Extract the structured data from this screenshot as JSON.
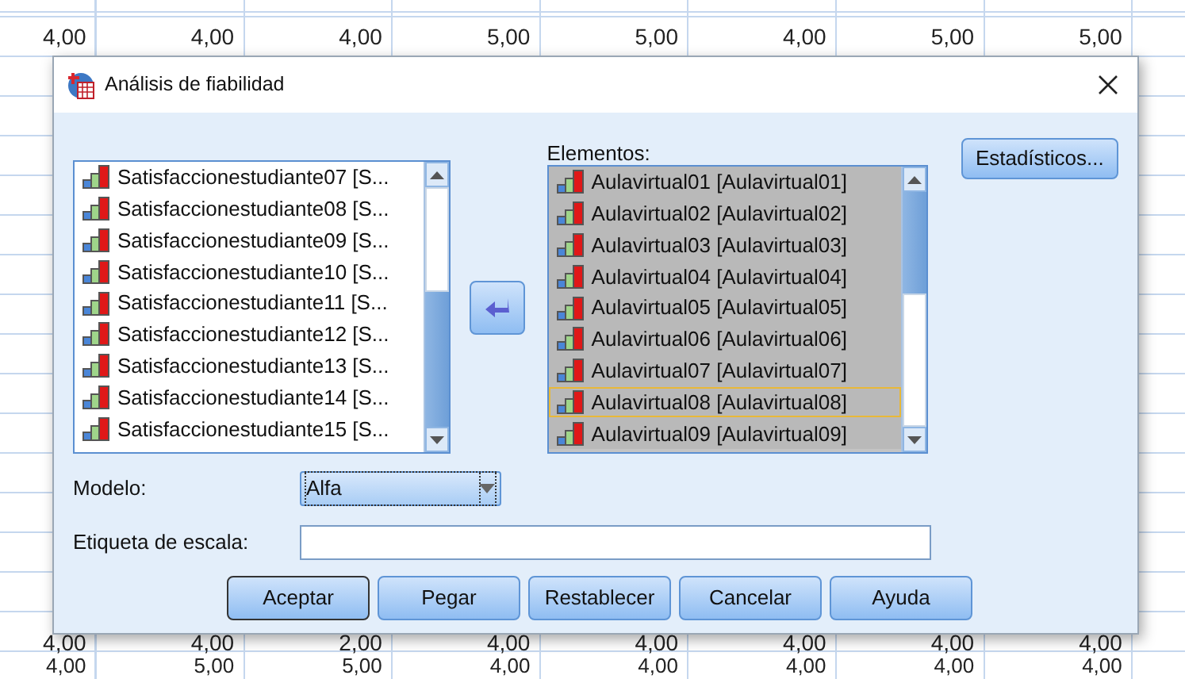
{
  "data_grid": {
    "top_rows": [
      {
        "cells": [
          "4,00",
          "4,00",
          "4,00",
          "5,00",
          "5,00",
          "4,00",
          "5,00",
          "5,00"
        ]
      }
    ],
    "bottom_rows": [
      {
        "cells": [
          "4,00",
          "4,00",
          "2,00",
          "4,00",
          "4,00",
          "4,00",
          "4,00",
          "4,00"
        ]
      },
      {
        "cells": [
          "4,00",
          "5,00",
          "5,00",
          "4,00",
          "4,00",
          "4,00",
          "4,00",
          "4,00"
        ]
      }
    ]
  },
  "dialog": {
    "title": "Análisis de fiabilidad",
    "source_list": {
      "items": [
        {
          "label": "Satisfaccionestudiante07 [S...",
          "selected": false
        },
        {
          "label": "Satisfaccionestudiante08 [S...",
          "selected": false
        },
        {
          "label": "Satisfaccionestudiante09 [S...",
          "selected": false
        },
        {
          "label": "Satisfaccionestudiante10 [S...",
          "selected": false
        },
        {
          "label": "Satisfaccionestudiante11 [S...",
          "selected": false
        },
        {
          "label": "Satisfaccionestudiante12 [S...",
          "selected": false
        },
        {
          "label": "Satisfaccionestudiante13 [S...",
          "selected": false
        },
        {
          "label": "Satisfaccionestudiante14 [S...",
          "selected": false
        },
        {
          "label": "Satisfaccionestudiante15 [S...",
          "selected": false
        }
      ]
    },
    "items_list": {
      "label": "Elementos:",
      "items": [
        {
          "label": "Aulavirtual01 [Aulavirtual01]",
          "selected": true,
          "focused": false
        },
        {
          "label": "Aulavirtual02 [Aulavirtual02]",
          "selected": true,
          "focused": false
        },
        {
          "label": "Aulavirtual03 [Aulavirtual03]",
          "selected": true,
          "focused": false
        },
        {
          "label": "Aulavirtual04 [Aulavirtual04]",
          "selected": true,
          "focused": false
        },
        {
          "label": "Aulavirtual05 [Aulavirtual05]",
          "selected": true,
          "focused": false
        },
        {
          "label": "Aulavirtual06 [Aulavirtual06]",
          "selected": true,
          "focused": false
        },
        {
          "label": "Aulavirtual07 [Aulavirtual07]",
          "selected": true,
          "focused": false
        },
        {
          "label": "Aulavirtual08 [Aulavirtual08]",
          "selected": true,
          "focused": true
        },
        {
          "label": "Aulavirtual09 [Aulavirtual09]",
          "selected": true,
          "focused": false
        }
      ]
    },
    "statistics_button": {
      "label": "Estadísticos..."
    },
    "model": {
      "label": "Modelo:",
      "value": "Alfa"
    },
    "scale_label": {
      "label": "Etiqueta de escala:"
    },
    "buttons": [
      {
        "label": "Aceptar",
        "default": true
      },
      {
        "label": "Pegar",
        "default": false
      },
      {
        "label": "Restablecer",
        "default": false
      },
      {
        "label": "Cancelar",
        "default": false
      },
      {
        "label": "Ayuda",
        "default": false
      }
    ]
  }
}
